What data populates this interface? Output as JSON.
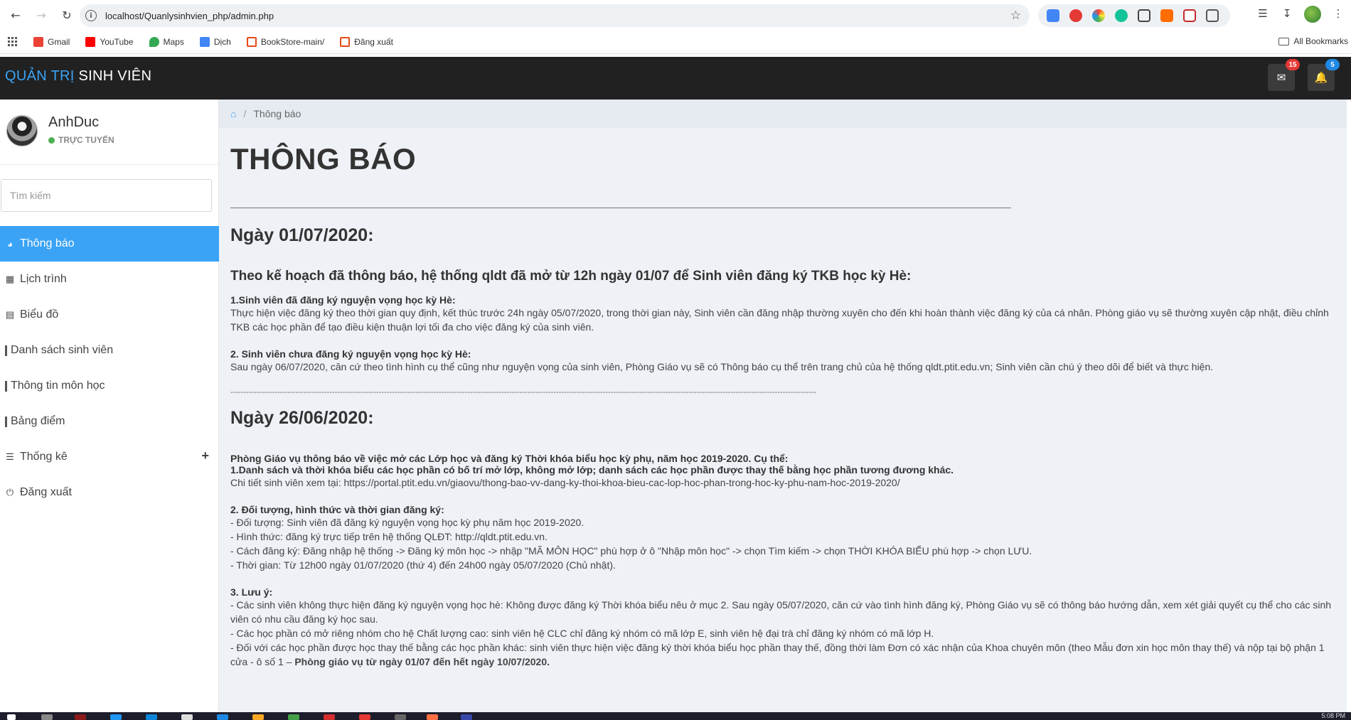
{
  "browser": {
    "url": "localhost/Quanlysinhvien_php/admin.php",
    "bookmarks": [
      {
        "label": "Gmail",
        "color": "#ea4335"
      },
      {
        "label": "YouTube",
        "color": "#ff0000"
      },
      {
        "label": "Maps",
        "color": "#34a853"
      },
      {
        "label": "Dịch",
        "color": "#4285f4"
      },
      {
        "label": "BookStore-main/",
        "color": "#e64a19"
      },
      {
        "label": "Đăng xuất",
        "color": "#e64a19"
      }
    ],
    "all_bookmarks": "All Bookmarks"
  },
  "header": {
    "brand_part1": "QUẢN TRỊ",
    "brand_part2": "SINH VIÊN",
    "mail_badge": "15",
    "notif_badge": "5",
    "mail_badge_color": "#e53935",
    "notif_badge_color": "#1e88e5"
  },
  "sidebar": {
    "user_name": "AnhDuc",
    "user_status": "TRỰC TUYẾN",
    "search_placeholder": "Tìm kiếm",
    "items": [
      {
        "label": "Thông báo",
        "icon": "dashboard-icon"
      },
      {
        "label": "Lịch trình",
        "icon": "calendar-icon"
      },
      {
        "label": "Biểu đồ",
        "icon": "bar-chart-icon"
      },
      {
        "label": "Danh sách sinh viên",
        "icon": "bar-icon"
      },
      {
        "label": "Thông tin môn học",
        "icon": "bar-icon"
      },
      {
        "label": "Bảng điểm",
        "icon": "bar-icon"
      },
      {
        "label": "Thống kê",
        "icon": "list-icon"
      },
      {
        "label": "Đăng xuất",
        "icon": "power-icon"
      }
    ]
  },
  "breadcrumb": {
    "current": "Thông báo"
  },
  "content": {
    "title": "THÔNG BÁO",
    "section1": {
      "date": "Ngày 01/07/2020:",
      "heading": "Theo kế hoạch đã thông báo, hệ thống qldt đã mở từ 12h ngày 01/07 để Sinh viên đăng ký TKB học kỳ Hè:",
      "p1_title": "1.Sinh viên đã đăng ký nguyện vọng học kỳ Hè:",
      "p1_text": "Thực hiện việc đăng ký theo thời gian quy định, kết thúc trước 24h ngày 05/07/2020, trong thời gian này, Sinh viên cần đăng nhập thường xuyên cho đến khi hoàn thành việc đăng ký của cá nhân. Phòng giáo vụ sẽ thường xuyên cập nhật, điều chỉnh TKB các học phần để tạo điều kiện thuận lợi tối đa cho việc đăng ký của sinh viên.",
      "p2_title": "2. Sinh viên chưa đăng ký nguyện vọng học kỳ Hè:",
      "p2_text": "Sau ngày 06/07/2020, căn cứ theo tình hình cụ thể cũng như nguyện vọng của sinh viên, Phòng Giáo vụ sẽ có Thông báo cụ thể trên trang chủ của hệ thống qldt.ptit.edu.vn; Sinh viên cần chú ý theo dõi để biết và thực hiện."
    },
    "divider": "------------------------------------------------------------------------------------------------------------------------------------------------------------------------------------------------------------------------------------------------------------------------------------",
    "section2": {
      "date": "Ngày 26/06/2020:",
      "intro": "Phòng Giáo vụ thông báo về việc mở các Lớp học và đăng ký Thời khóa biểu học kỳ phụ, năm học 2019-2020. Cụ thể:",
      "p1_title": "1.Danh sách và thời khóa biểu các học phần có bố trí mở lớp, không mở lớp; danh sách các học phần được thay thế bằng học phần tương đương khác.",
      "p1_text": "Chi tiết sinh viên xem tại: https://portal.ptit.edu.vn/giaovu/thong-bao-vv-dang-ky-thoi-khoa-bieu-cac-lop-hoc-phan-trong-hoc-ky-phu-nam-hoc-2019-2020/",
      "p2_title": "2. Đối tượng, hình thức và thời gian đăng ký:",
      "p2_lines": [
        "- Đối tượng: Sinh viên đã đăng ký nguyện vọng học kỳ phụ năm học 2019-2020.",
        "- Hình thức: đăng ký trực tiếp trên hệ thống QLĐT: http://qldt.ptit.edu.vn.",
        "- Cách đăng ký: Đăng nhập hệ thống -> Đăng ký môn học -> nhập \"MÃ MÔN HỌC\" phù hợp ở ô \"Nhập môn học\" -> chọn Tìm kiếm -> chọn THỜI KHÓA BIỂU phù hợp -> chọn LƯU.",
        "- Thời gian: Từ 12h00 ngày 01/07/2020 (thứ 4) đến 24h00 ngày 05/07/2020 (Chủ nhật)."
      ],
      "p3_title": "3. Lưu ý:",
      "p3_lines": [
        "- Các sinh viên không thực hiện đăng ký nguyện vọng học hè: Không được đăng ký Thời khóa biểu nêu ở mục 2. Sau ngày 05/07/2020, căn cứ vào tình hình đăng ký, Phòng Giáo vụ sẽ có thông báo hướng dẫn, xem xét giải quyết cụ thể cho các sinh viên có nhu cầu đăng ký học sau.",
        "- Các học phần có mở riêng nhóm cho hệ Chất lượng cao: sinh viên hệ CLC chỉ đăng ký nhóm có mã lớp E, sinh viên hệ đại trà chỉ đăng ký nhóm có mã lớp H."
      ],
      "p3_last_text": "- Đối với các học phần được học thay thế bằng các học phần khác: sinh viên thực hiện việc đăng ký thời khóa biểu học phần thay thế, đồng thời làm Đơn có xác nhận của Khoa chuyên môn (theo Mẫu đơn xin học môn thay thế) và nộp tại bộ phận 1 cửa - ô số 1 –",
      "p3_last_bold": "Phòng giáo vụ từ ngày 01/07 đến hết ngày 10/07/2020."
    }
  },
  "taskbar": {
    "time": "5:08 PM"
  },
  "colors": {
    "accent": "#3aa3f5",
    "header_bg": "#212121",
    "content_bg": "#eef1f6"
  }
}
